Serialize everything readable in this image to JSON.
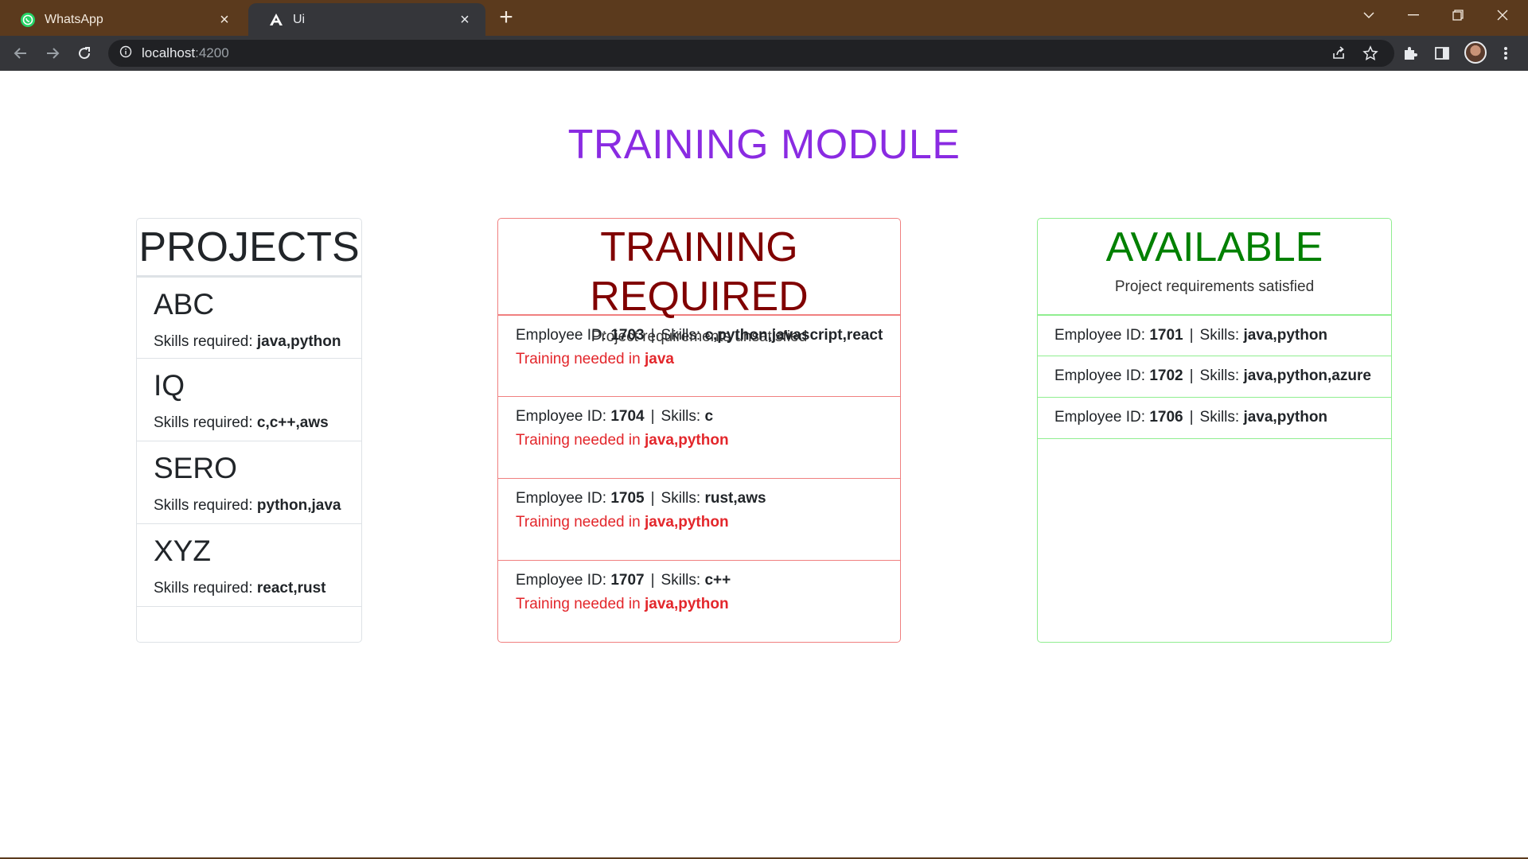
{
  "browser": {
    "tabs": [
      {
        "title": "WhatsApp",
        "icon": "whatsapp-icon",
        "active": false
      },
      {
        "title": "Ui",
        "icon": "angular-icon",
        "active": true
      }
    ],
    "address": {
      "host": "localhost",
      "port": ":4200"
    },
    "colors": {
      "frame": "#5b3a1d",
      "toolbar": "#35363a",
      "omnibox": "#202124"
    }
  },
  "page": {
    "title": "TRAINING MODULE",
    "title_color": "#8a2be2"
  },
  "projects": {
    "heading": "PROJECTS",
    "req_label": "Skills required: ",
    "items": [
      {
        "name": "ABC",
        "skills": "java,python"
      },
      {
        "name": "IQ",
        "skills": "c,c++,aws"
      },
      {
        "name": "SERO",
        "skills": "python,java"
      },
      {
        "name": "XYZ",
        "skills": "react,rust"
      }
    ]
  },
  "training": {
    "heading": "TRAINING REQUIRED",
    "subtitle": "Project requirements unsatisfied",
    "id_label": "Employee ID: ",
    "skills_label": "Skills: ",
    "separator": "|",
    "needed_label": "Training needed in ",
    "heading_color": "#800000",
    "needed_color": "#e3262b",
    "items": [
      {
        "id": "1703",
        "skills": "c,python,javascript,react",
        "needed": "java"
      },
      {
        "id": "1704",
        "skills": "c",
        "needed": "java,python"
      },
      {
        "id": "1705",
        "skills": "rust,aws",
        "needed": "java,python"
      },
      {
        "id": "1707",
        "skills": "c++",
        "needed": "java,python"
      }
    ]
  },
  "available": {
    "heading": "AVAILABLE",
    "subtitle": "Project requirements satisfied",
    "id_label": "Employee ID: ",
    "skills_label": "Skills: ",
    "separator": "|",
    "heading_color": "#008000",
    "items": [
      {
        "id": "1701",
        "skills": "java,python"
      },
      {
        "id": "1702",
        "skills": "java,python,azure"
      },
      {
        "id": "1706",
        "skills": "java,python"
      }
    ]
  }
}
